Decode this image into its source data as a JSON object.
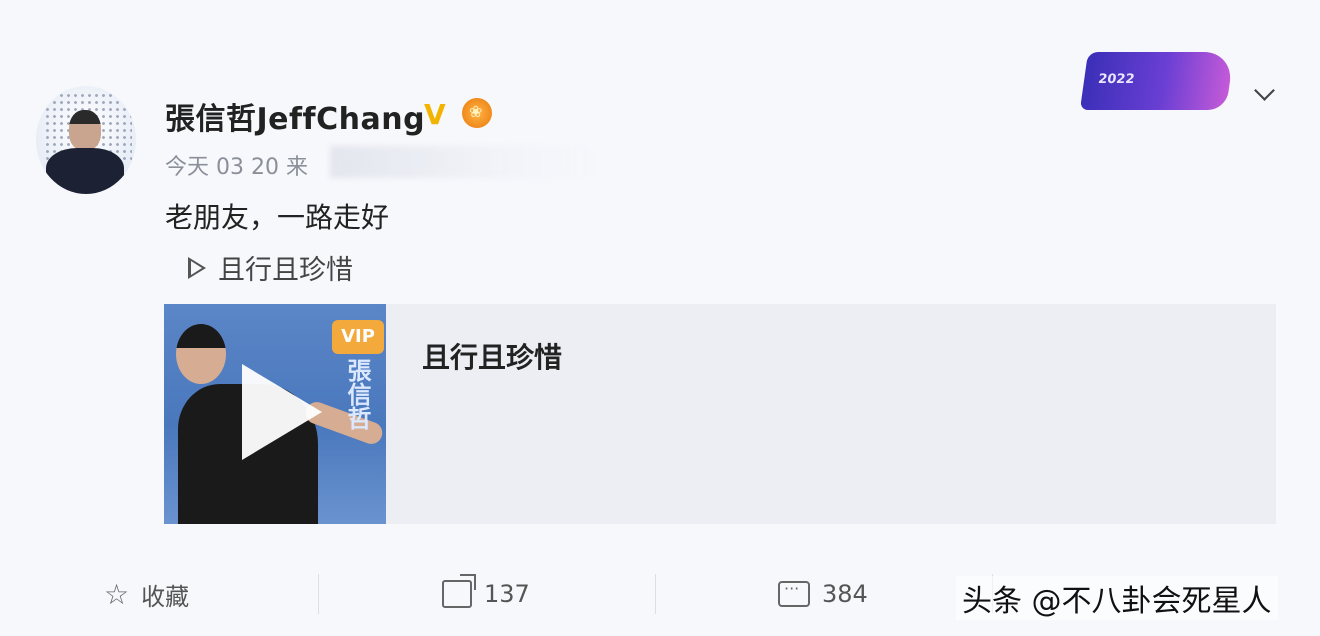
{
  "post": {
    "username": "張信哲JeffChang",
    "verified_badge": "V",
    "medal_icon": "medal-icon",
    "meta": "今天 03 20 来",
    "content": "老朋友，一路走好",
    "music_link_label": "且行且珍惜"
  },
  "media_card": {
    "title": "且行且珍惜",
    "cover_badge": "VIP",
    "cover_vertical_text": "張信哲"
  },
  "actions": {
    "favorite_label": "收藏",
    "share_count": "137",
    "comment_count": "384"
  },
  "watermark": "头条 @不八卦会死星人",
  "colors": {
    "verified": "#f2b400",
    "vip": "#f3a93c",
    "background": "#f7f8fc"
  }
}
